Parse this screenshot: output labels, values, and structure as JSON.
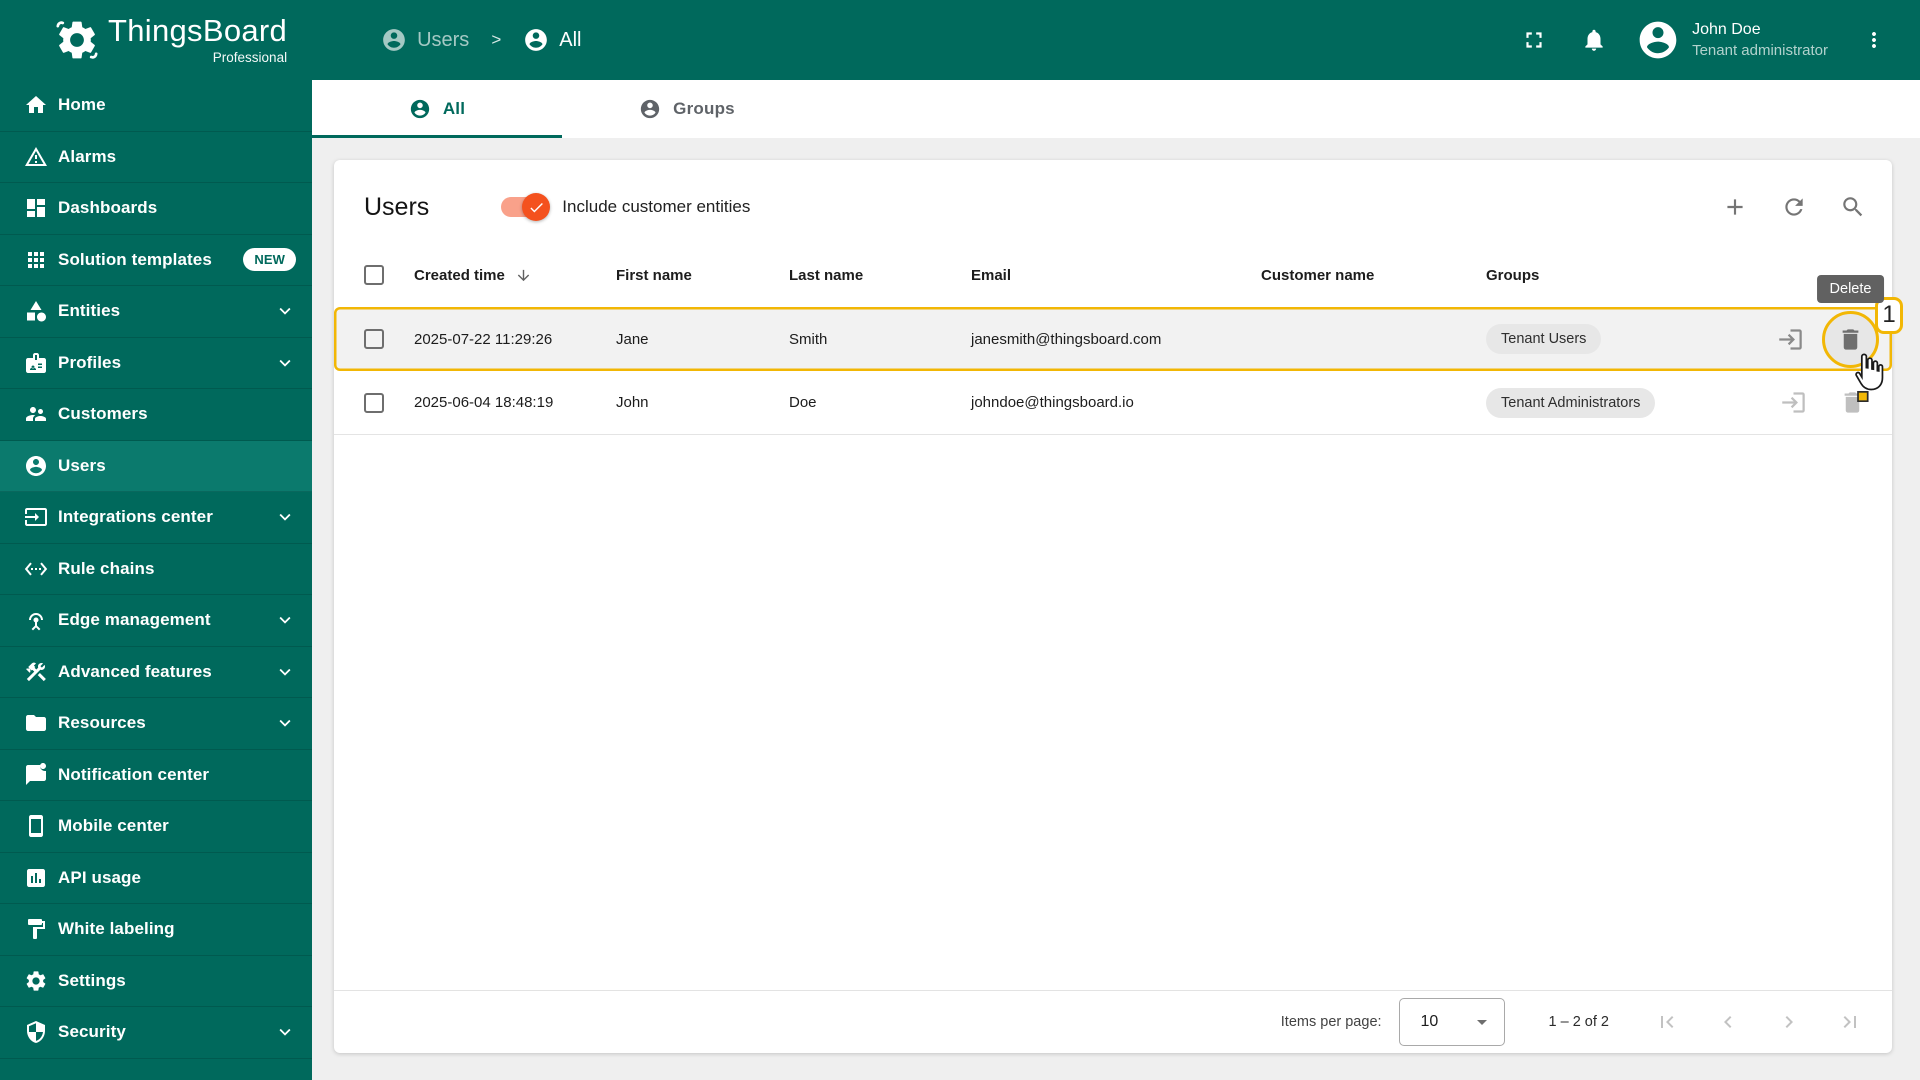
{
  "colors": {
    "primary_teal": "#00695c",
    "sidebar_active": "#0b7a6d",
    "highlight_yellow": "#f2b705",
    "toggle_orange": "#f4511e",
    "tooltip_gray": "#616161",
    "chip_gray": "#e7e7e7"
  },
  "header": {
    "brand": "ThingsBoard",
    "brand_sub": "Professional",
    "breadcrumb": {
      "items": [
        {
          "label": "Users"
        },
        {
          "label": "All"
        }
      ],
      "separator": ">"
    },
    "user": {
      "name": "John Doe",
      "role": "Tenant administrator"
    }
  },
  "sidebar": {
    "items": [
      {
        "label": "Home",
        "icon": "home"
      },
      {
        "label": "Alarms",
        "icon": "warning"
      },
      {
        "label": "Dashboards",
        "icon": "dashboard"
      },
      {
        "label": "Solution templates",
        "icon": "apps",
        "badge": "NEW"
      },
      {
        "label": "Entities",
        "icon": "category",
        "expandable": true
      },
      {
        "label": "Profiles",
        "icon": "badge",
        "expandable": true
      },
      {
        "label": "Customers",
        "icon": "people"
      },
      {
        "label": "Users",
        "icon": "account-circle",
        "active": true
      },
      {
        "label": "Integrations center",
        "icon": "input",
        "expandable": true
      },
      {
        "label": "Rule chains",
        "icon": "settings-ethernet"
      },
      {
        "label": "Edge management",
        "icon": "antenna",
        "expandable": true
      },
      {
        "label": "Advanced features",
        "icon": "construction",
        "expandable": true
      },
      {
        "label": "Resources",
        "icon": "folder",
        "expandable": true
      },
      {
        "label": "Notification center",
        "icon": "chat-unread"
      },
      {
        "label": "Mobile center",
        "icon": "smartphone"
      },
      {
        "label": "API usage",
        "icon": "bar-chart"
      },
      {
        "label": "White labeling",
        "icon": "format-paint"
      },
      {
        "label": "Settings",
        "icon": "gear"
      },
      {
        "label": "Security",
        "icon": "shield",
        "expandable": true
      }
    ]
  },
  "tabs": [
    {
      "label": "All",
      "active": true
    },
    {
      "label": "Groups",
      "active": false
    }
  ],
  "panel": {
    "title": "Users",
    "toggle_label": "Include customer entities",
    "toggle_on": true
  },
  "table": {
    "columns": [
      {
        "label": "Created time",
        "sorted": "desc"
      },
      {
        "label": "First name"
      },
      {
        "label": "Last name"
      },
      {
        "label": "Email"
      },
      {
        "label": "Customer name"
      },
      {
        "label": "Groups"
      }
    ],
    "rows": [
      {
        "created_time": "2025-07-22 11:29:26",
        "first_name": "Jane",
        "last_name": "Smith",
        "email": "janesmith@thingsboard.com",
        "customer_name": "",
        "groups": [
          "Tenant Users"
        ],
        "highlighted": true
      },
      {
        "created_time": "2025-06-04 18:48:19",
        "first_name": "John",
        "last_name": "Doe",
        "email": "johndoe@thingsboard.io",
        "customer_name": "",
        "groups": [
          "Tenant Administrators"
        ],
        "highlighted": false
      }
    ]
  },
  "tutorial": {
    "tooltip": "Delete",
    "step_badge": "1"
  },
  "pagination": {
    "label": "Items per page:",
    "value": "10",
    "range": "1 – 2 of 2"
  }
}
